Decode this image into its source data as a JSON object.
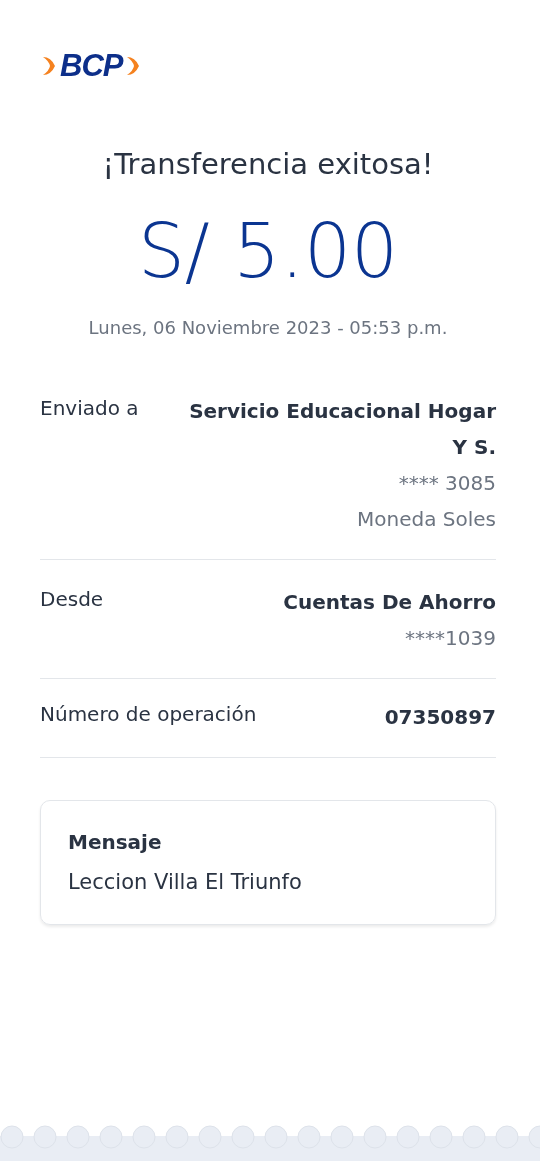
{
  "logo": {
    "text": "BCP"
  },
  "title": "¡Transferencia exitosa!",
  "amount": "S/ 5.00",
  "date": "Lunes, 06 Noviembre 2023 - 05:53 p.m.",
  "details": [
    {
      "label": "Enviado a",
      "value": "Servicio Educacional Hogar Y S.",
      "extra": [
        "**** 3085",
        "Moneda Soles"
      ]
    },
    {
      "label": "Desde",
      "value": "Cuentas De Ahorro",
      "extra": [
        "****1039"
      ]
    },
    {
      "label": "Número de operación",
      "value": "07350897"
    }
  ],
  "message": {
    "title": "Mensaje",
    "text": "Leccion Villa El Triunfo"
  }
}
